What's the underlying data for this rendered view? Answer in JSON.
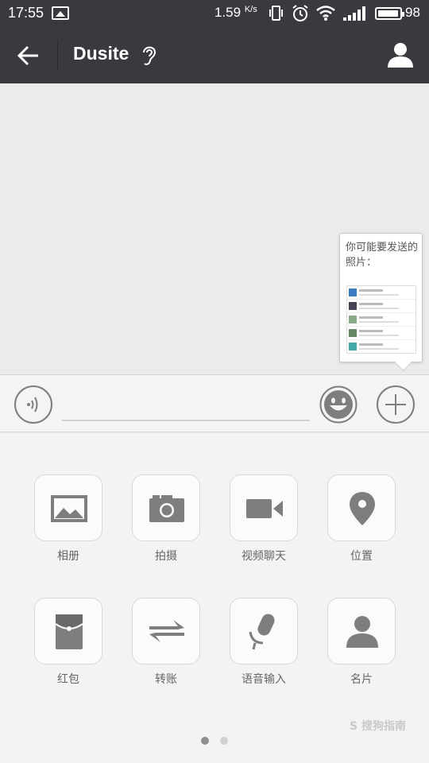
{
  "status_bar": {
    "time": "17:55",
    "net_speed_value": "1.59",
    "net_speed_unit": "K/s",
    "battery": "98",
    "battery_level": 0.98,
    "icons": [
      "image-notification-icon",
      "vibrate-icon",
      "alarm-icon",
      "wifi-icon",
      "signal-icon",
      "battery-icon"
    ]
  },
  "header": {
    "title": "Dusite",
    "back_icon": "arrow-left-icon",
    "ear_icon": "earpiece-icon",
    "profile_icon": "person-icon"
  },
  "photo_suggestion": {
    "hint": "你可能要发送的照片："
  },
  "input_bar": {
    "value": "",
    "voice_icon": "voice-icon",
    "emoji_icon": "smiley-icon",
    "more_icon": "plus-icon"
  },
  "panel": {
    "items": [
      {
        "label": "相册",
        "icon": "album-icon"
      },
      {
        "label": "拍摄",
        "icon": "camera-icon"
      },
      {
        "label": "视频聊天",
        "icon": "video-call-icon"
      },
      {
        "label": "位置",
        "icon": "location-icon"
      },
      {
        "label": "红包",
        "icon": "red-packet-icon"
      },
      {
        "label": "转账",
        "icon": "transfer-icon"
      },
      {
        "label": "语音输入",
        "icon": "microphone-icon"
      },
      {
        "label": "名片",
        "icon": "contact-card-icon"
      }
    ],
    "page_count": 2,
    "active_page": 1
  },
  "watermark": {
    "text": "S 搜狗指南"
  },
  "colors": {
    "header_bg": "#393a3f",
    "chat_bg": "#ebebeb",
    "icon_gray": "#7e7e7e",
    "dot_active": "#8e8e8e",
    "dot_inactive": "#d0d0d0"
  }
}
